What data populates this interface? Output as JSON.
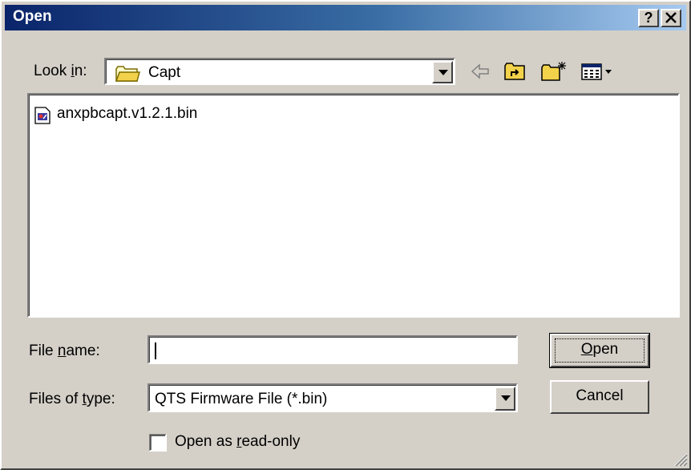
{
  "window": {
    "title": "Open",
    "help_label": "?",
    "close_label": "✕"
  },
  "lookin": {
    "label_pre": "Look ",
    "label_accel": "i",
    "label_post": "n:",
    "value": "Capt"
  },
  "toolbar": {
    "back_icon": "back-arrow-icon",
    "up_icon": "up-one-level-icon",
    "newfolder_icon": "new-folder-icon",
    "views_icon": "views-menu-icon"
  },
  "files": [
    {
      "name": "anxpbcapt.v1.2.1.bin"
    }
  ],
  "filename": {
    "label_pre": "File ",
    "label_accel": "n",
    "label_post": "ame:",
    "value": ""
  },
  "filetype": {
    "label_pre": "Files of ",
    "label_accel": "t",
    "label_post": "ype:",
    "value": "QTS Firmware File (*.bin)"
  },
  "buttons": {
    "open_accel": "O",
    "open_rest": "pen",
    "cancel": "Cancel"
  },
  "readonly": {
    "label_pre": "Open as ",
    "label_accel": "r",
    "label_post": "ead-only",
    "checked": false
  },
  "colors": {
    "face": "#d4d0c8",
    "title_start": "#0a246a",
    "title_end": "#a6caf0"
  }
}
